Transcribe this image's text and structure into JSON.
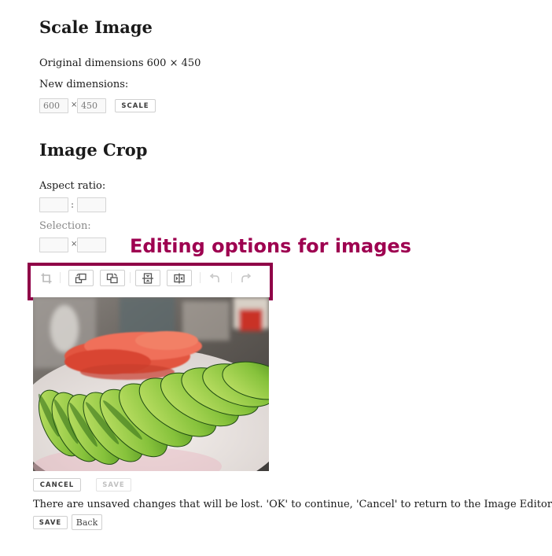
{
  "scale": {
    "title": "Scale Image",
    "original_label": "Original dimensions 600 × 450",
    "new_label": "New dimensions:",
    "width_value": "600",
    "height_value": "450",
    "times": "×",
    "scale_button": "SCALE"
  },
  "crop": {
    "title": "Image Crop",
    "aspect_label": "Aspect ratio:",
    "aspect_sep": ":",
    "selection_label": "Selection:",
    "selection_sep": "×"
  },
  "callout": "Editing options for images",
  "toolbar": {
    "tools": [
      "crop-icon",
      "rotate-left-icon",
      "rotate-right-icon",
      "flip-vertical-icon",
      "flip-horizontal-icon",
      "undo-icon",
      "redo-icon"
    ]
  },
  "editor_actions": {
    "cancel": "CANCEL",
    "save": "SAVE"
  },
  "confirm": {
    "message": "There are unsaved changes that will be lost. 'OK' to continue, 'Cancel' to return to the Image Editor.",
    "save": "SAVE",
    "back": "Back"
  }
}
